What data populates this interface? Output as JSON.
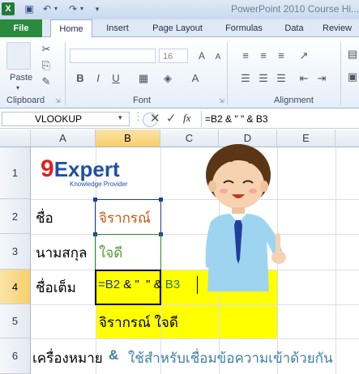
{
  "window": {
    "title": "PowerPoint 2010 Course Hi..."
  },
  "ribbon": {
    "tabs": [
      "File",
      "Home",
      "Insert",
      "Page Layout",
      "Formulas",
      "Data",
      "Review"
    ],
    "paste_label": "Paste",
    "font_size": "16",
    "groups": {
      "clipboard": "Clipboard",
      "font": "Font",
      "alignment": "Alignment"
    }
  },
  "formula_bar": {
    "name_box": "VLOOKUP",
    "fx": "fx",
    "formula": "=B2 & \"  \" & B3"
  },
  "columns": [
    "A",
    "B",
    "C",
    "D",
    "E"
  ],
  "rows": [
    "1",
    "2",
    "3",
    "4",
    "5",
    "6"
  ],
  "cells": {
    "logo_9": "9",
    "logo_expert": "Expert",
    "logo_tagline": "Knowledge Provider",
    "A2": "ชื่อ",
    "B2": "จิรากรณ์",
    "A3": "นามสกุล",
    "B3": "ใจดี",
    "A4": "ชื่อเต็ม",
    "B4_part1": "=B2",
    "B4_part2": " & \"  \" & ",
    "B4_part3": "B3",
    "B5": "จิรากรณ์  ใจดี",
    "A6": "เครื่องหมาย",
    "B6_amp": "&",
    "B6_text": "ใช้สำหรับเชื่อมข้อความเข้าด้วยกัน"
  },
  "colors": {
    "file_tab": "#2a8a3e",
    "highlight": "#ffff00",
    "b2_text": "#c55a11",
    "b3_text": "#5b9a32",
    "ref_blue": "#1f3f8f",
    "note_text": "#3d7fa6"
  }
}
